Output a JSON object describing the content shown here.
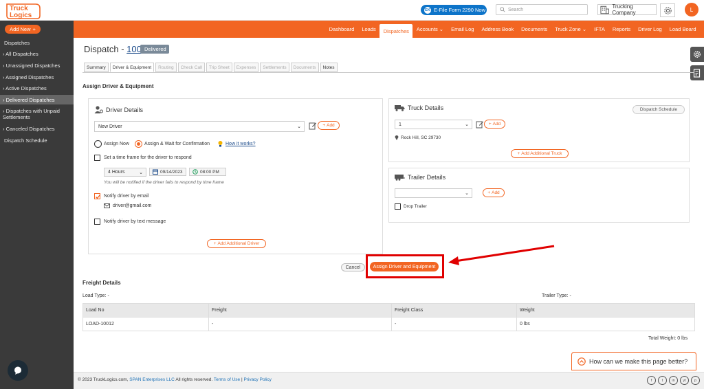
{
  "brand": {
    "logo_line1": "Truck",
    "logo_line2": "Logics"
  },
  "header": {
    "efile_badge": "EK",
    "efile_label": "E-File Form 2290 Now",
    "search_placeholder": "Search",
    "company": "Trucking Company",
    "avatar_initial": "L"
  },
  "nav": [
    "Dashboard",
    "Loads",
    "Dispatches",
    "Accounts ⌄",
    "Email Log",
    "Address Book",
    "Documents",
    "Truck Zone ⌄",
    "IFTA",
    "Reports",
    "Driver Log",
    "Load Board"
  ],
  "sidebar": {
    "add_new": "Add New",
    "heading": "Dispatches",
    "items": [
      "All Dispatches",
      "Unassigned Dispatches",
      "Assigned Dispatches",
      "Active Dispatches",
      "Delivered Dispatches",
      "Dispatches with Unpaid Settlements",
      "Canceled Dispatches"
    ],
    "schedule": "Dispatch Schedule"
  },
  "page": {
    "title_prefix": "Dispatch - ",
    "dispatch_no": "100",
    "status": "Delivered"
  },
  "tabs": [
    "Summary",
    "Driver & Equipment",
    "Routing",
    "Check Call",
    "Trip Sheet",
    "Expenses",
    "Settlements",
    "Documents",
    "Notes"
  ],
  "assign_heading": "Assign Driver & Equipment",
  "driver": {
    "title": "Driver Details",
    "selected": "New Driver",
    "add": "Add",
    "assign_now": "Assign Now",
    "assign_wait": "Assign & Wait for Confirmation",
    "how_it_works": "How it works?",
    "timeframe_label": "Set a time frame for the driver to respond",
    "hours": "4 Hours",
    "date": "09/14/2023",
    "time": "08:00 PM",
    "notify_note": "You will be notified if the driver fails to respond by time frame",
    "notify_email_label": "Notify driver by email",
    "email": "driver@gmail.com",
    "notify_text_label": "Notify driver by text message",
    "add_additional": "Add Additional Driver"
  },
  "truck": {
    "title": "Truck Details",
    "schedule_btn": "Dispatch Schedule",
    "selected": "1",
    "add": "Add",
    "location": "Rock Hill, SC 29730",
    "add_additional": "Add Additional Truck"
  },
  "trailer": {
    "title": "Trailer Details",
    "add": "Add",
    "drop_label": "Drop Trailer"
  },
  "actions": {
    "cancel": "Cancel",
    "assign": "Assign Driver and Equipment"
  },
  "freight": {
    "heading": "Freight Details",
    "load_type": "Load Type: -",
    "trailer_type": "Trailer Type: -",
    "columns": [
      "Load No",
      "Freight",
      "Freight Class",
      "Weight"
    ],
    "rows": [
      [
        "LOAD-10012",
        "-",
        "-",
        "0 lbs"
      ]
    ],
    "total_weight": "Total Weight:   0 lbs"
  },
  "feedback": "How can we make this page better?",
  "footer": {
    "copy_prefix": "© 2023 TruckLogics.com, ",
    "span": "SPAN Enterprises LLC",
    "rights": " All rights reserved. ",
    "terms": "Terms of Use",
    "sep": " | ",
    "privacy": "Privacy Policy",
    "social": [
      "f",
      "t",
      "in",
      "yt",
      "p"
    ]
  },
  "colors": {
    "accent": "#f26522",
    "sidebar": "#3a3a3a",
    "efile": "#0d74c9",
    "highlight": "#e00000"
  }
}
